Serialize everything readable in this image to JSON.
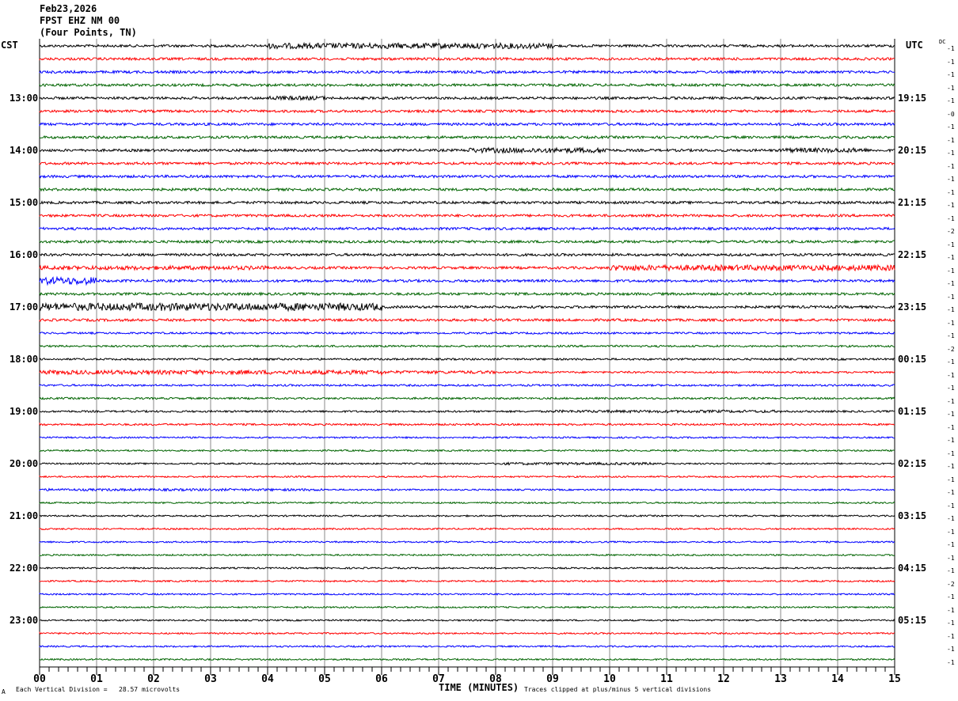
{
  "header": {
    "date": "Feb23,2026",
    "station": "FPST EHZ NM 00",
    "location": "(Four Points, TN)"
  },
  "chart_data": {
    "type": "line",
    "title": "FPST EHZ NM 00",
    "xlabel": "TIME (MINUTES)",
    "xlim": [
      0,
      15
    ],
    "x_ticks": [
      "00",
      "01",
      "02",
      "03",
      "04",
      "05",
      "06",
      "07",
      "08",
      "09",
      "10",
      "11",
      "12",
      "13",
      "14",
      "15"
    ],
    "left_axis_label": "CST",
    "right_axis_label": "UTC",
    "dc_label": "DC",
    "left_time_labels": [
      "13:00",
      "14:00",
      "15:00",
      "16:00",
      "17:00",
      "18:00",
      "19:00",
      "20:00",
      "21:00",
      "22:00",
      "23:00"
    ],
    "right_time_labels": [
      "19:15",
      "20:15",
      "21:15",
      "22:15",
      "23:15",
      "00:15",
      "01:15",
      "02:15",
      "03:15",
      "04:15",
      "05:15"
    ],
    "trace_colors": [
      "#000000",
      "#ff0000",
      "#0000ff",
      "#006400"
    ],
    "dc_offsets": [
      "-1",
      "-1",
      "-1",
      "-1",
      "-1",
      "-0",
      "-1",
      "-1",
      "-1",
      "-1",
      "-1",
      "-1",
      "-1",
      "-1",
      "-2",
      "-1",
      "-1",
      "-1",
      "-1",
      "-1",
      "-1",
      "-1",
      "-1",
      "-2",
      "-1",
      "-1",
      "-1",
      "-1",
      "-1",
      "-1",
      "-1",
      "-1",
      "-1",
      "-1",
      "-1",
      "-1",
      "-1",
      "-1",
      "-1",
      "-1",
      "-1",
      "-2",
      "-1",
      "-1",
      "-1",
      "-1",
      "-1",
      "-1"
    ],
    "grid": true
  },
  "footer": {
    "scale_note": "Each Vertical Division =   28.57 microvolts",
    "clip_note": "Traces clipped at plus/minus 5 vertical divisions",
    "corner_mark": "A"
  }
}
